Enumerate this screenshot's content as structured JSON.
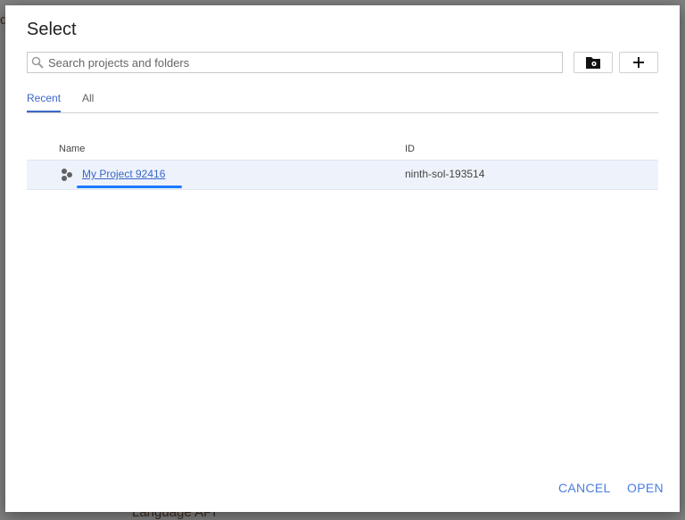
{
  "dialog": {
    "title": "Select",
    "search": {
      "placeholder": "Search projects and folders",
      "value": ""
    },
    "tabs": [
      {
        "label": "Recent",
        "active": true
      },
      {
        "label": "All",
        "active": false
      }
    ],
    "table": {
      "columns": [
        "Name",
        "ID"
      ],
      "rows": [
        {
          "name": "My Project 92416",
          "id": "ninth-sol-193514",
          "icon": "project-hexagons-icon"
        }
      ]
    },
    "actions": {
      "cancel": "CANCEL",
      "open": "OPEN"
    },
    "icons": {
      "manage": "folder-gear-icon",
      "new": "plus-icon",
      "search": "search-icon"
    }
  },
  "colors": {
    "accent": "#3b67c8",
    "selected_row": "#eef3fb",
    "backdrop": "#808080"
  }
}
